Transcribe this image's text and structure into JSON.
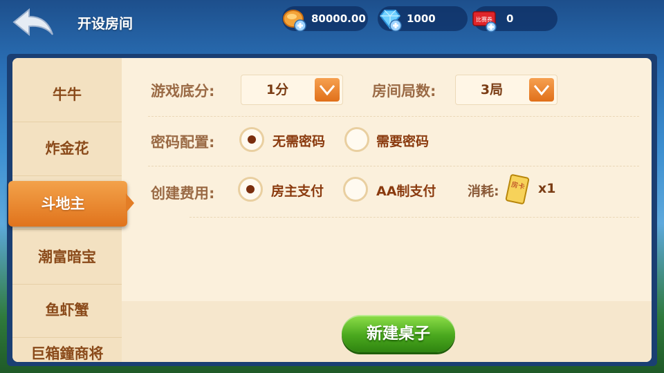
{
  "header": {
    "title": "开设房间",
    "back_icon": "back-arrow-icon",
    "currencies": [
      {
        "name": "gold-coin-icon",
        "value": "80000.00"
      },
      {
        "name": "diamond-icon",
        "value": "1000"
      },
      {
        "name": "match-ticket-icon",
        "value": "0",
        "ticket_text": "比赛券"
      }
    ]
  },
  "sidebar": {
    "items": [
      "牛牛",
      "炸金花",
      "斗地主",
      "潮富暗宝",
      "鱼虾蟹",
      "巨箱鐘商将"
    ],
    "active": "斗地主"
  },
  "form": {
    "base_score_label": "游戏底分:",
    "base_score_value": "1分",
    "rounds_label": "房间局数:",
    "rounds_value": "3局",
    "password_label": "密码配置:",
    "password_options": [
      "无需密码",
      "需要密码"
    ],
    "password_selected": "无需密码",
    "fee_label": "创建费用:",
    "fee_options": [
      "房主支付",
      "AA制支付"
    ],
    "fee_selected": "房主支付",
    "consume_label": "消耗:",
    "consume_card_text": "房卡",
    "consume_count": "x1"
  },
  "actions": {
    "create_table": "新建桌子"
  },
  "colors": {
    "accent": "#e0731c",
    "create_button": "#4aa81e",
    "label_text": "#9a6a45"
  }
}
